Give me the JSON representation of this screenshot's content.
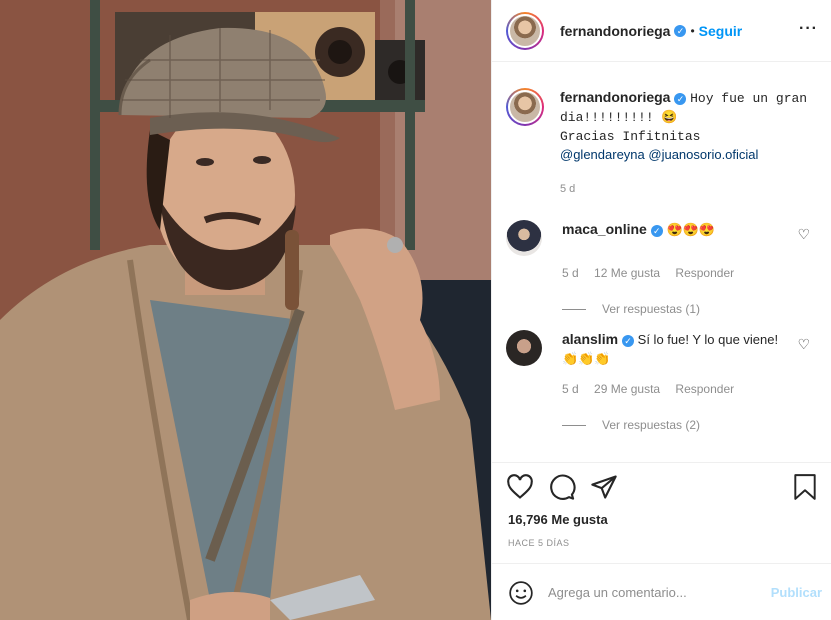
{
  "post": {
    "username": "fernandonoriega",
    "verified_badge": "✓",
    "separator": "•",
    "follow_label": "Seguir",
    "more_label": "···"
  },
  "caption": {
    "username": "fernandonoriega",
    "text_line1": "Hoy fue un gran",
    "text_line2": "dia!!!!!!!!! 😆",
    "text_line3": "Gracias Infitnitas",
    "mention1": "@glendareyna",
    "mention2": "@juanosorio.oficial",
    "age": "5 d"
  },
  "comments": [
    {
      "username": "maca_online",
      "text": "😍😍😍",
      "age": "5 d",
      "likes": "12 Me gusta",
      "reply_label": "Responder",
      "view_replies": "Ver respuestas (1)"
    },
    {
      "username": "alanslim",
      "text": "Sí lo fue! Y lo que viene!👏👏👏",
      "age": "5 d",
      "likes": "29 Me gusta",
      "reply_label": "Responder",
      "view_replies": "Ver respuestas (2)"
    }
  ],
  "actions": {
    "icons": [
      "heart-icon",
      "comment-icon",
      "share-icon",
      "bookmark-icon"
    ],
    "likes": "16,796 Me gusta",
    "timestamp": "HACE 5 DÍAS"
  },
  "add_comment": {
    "placeholder": "Agrega un comentario...",
    "publish_label": "Publicar"
  },
  "colors": {
    "link": "#0095f6",
    "verified": "#3897f0",
    "muted": "#8e8e8e",
    "publish_disabled": "#b2dffc"
  }
}
